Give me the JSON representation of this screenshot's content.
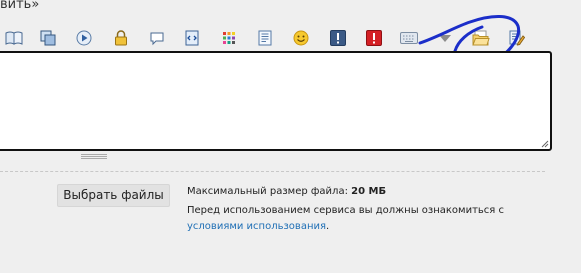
{
  "header": {
    "partial_title": "вить»"
  },
  "toolbar": {
    "buttons": [
      {
        "icon": "book-icon"
      },
      {
        "icon": "copy-pages-icon"
      },
      {
        "icon": "play-circle-icon"
      },
      {
        "icon": "lock-icon"
      },
      {
        "icon": "speech-bubble-icon"
      },
      {
        "icon": "code-document-icon"
      },
      {
        "icon": "color-palette-icon"
      },
      {
        "icon": "text-document-icon"
      },
      {
        "icon": "smiley-icon"
      },
      {
        "icon": "info-exclamation-icon"
      },
      {
        "icon": "alert-exclamation-icon"
      },
      {
        "icon": "keyboard-icon"
      },
      {
        "icon": "dropdown-triangle-icon"
      },
      {
        "icon": "folder-open-icon"
      },
      {
        "icon": "edit-document-icon"
      }
    ]
  },
  "editor": {
    "value": ""
  },
  "upload": {
    "choose_button_label": "Выбрать файлы",
    "max_size_label": "Максимальный размер файла:",
    "max_size_value": "20 МБ",
    "notice_text": "Перед использованием сервиса вы должны ознакомиться с",
    "terms_link_text": "условиями использования",
    "terms_suffix": "."
  },
  "colors": {
    "annotation_circle": "#1b2ec9",
    "link": "#1f6fb5",
    "background": "#efefef"
  }
}
